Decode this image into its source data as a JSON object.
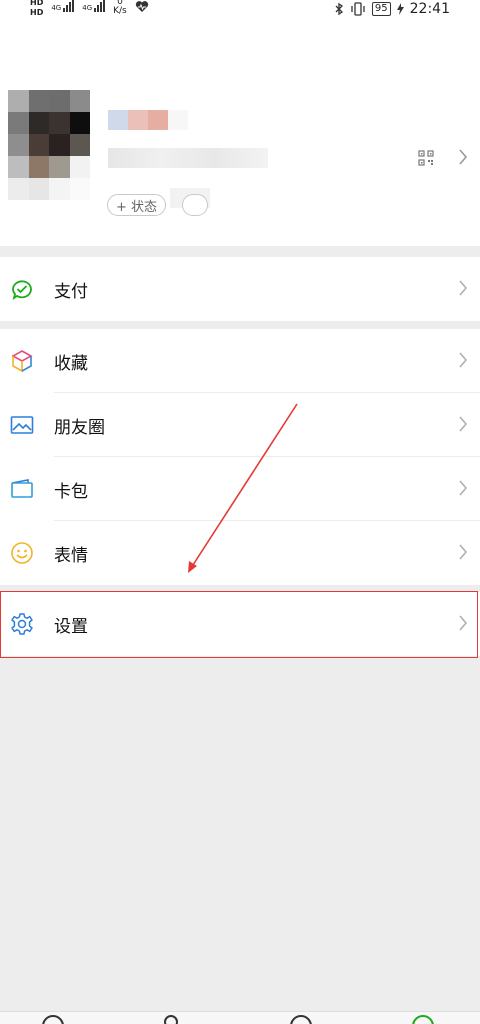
{
  "status_bar": {
    "hd_top": "HD",
    "hd_bottom": "HD",
    "net1": "4G",
    "net2": "4G",
    "speed_value": "0",
    "speed_unit": "K/s",
    "battery": "95",
    "time": "22:41"
  },
  "profile": {
    "status_button": "+ 状态"
  },
  "menu": {
    "pay": "支付",
    "favorites": "收藏",
    "moments": "朋友圈",
    "cards": "卡包",
    "stickers": "表情",
    "settings": "设置"
  },
  "colors": {
    "pay_green": "#1aad19",
    "settings_blue": "#2f7fd8",
    "highlight_red": "#e53935"
  }
}
